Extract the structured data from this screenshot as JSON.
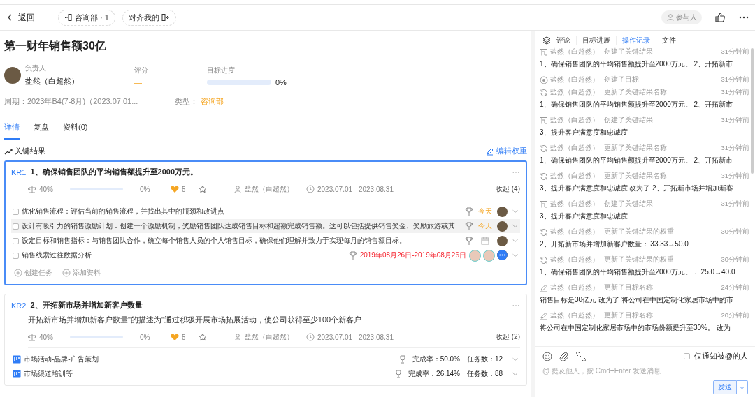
{
  "top_bar": {
    "back": "返回",
    "chips": [
      {
        "label": "咨询部 · 1",
        "kind": "in"
      },
      {
        "label": "对齐我的",
        "kind": "out"
      }
    ],
    "participants": "参与人"
  },
  "objective": {
    "title": "第一财年销售额30亿",
    "owner_label": "负责人",
    "owner": "盐然（白超然）",
    "score_label": "评分",
    "score": "—",
    "progress_label": "目标进度",
    "level": 0,
    "progress_text": "0%",
    "period": "周期：2023年B4(7-8月)（2023.07.01...",
    "type_label": "类型：",
    "type": "咨询部"
  },
  "tabs": [
    {
      "label": "详情",
      "selected": true
    },
    {
      "label": "复盘",
      "selected": false
    },
    {
      "label": "资料(0)",
      "selected": false
    }
  ],
  "section": {
    "title": "关键结果",
    "edit": "编辑权重"
  },
  "key_results": [
    {
      "code": "KR1",
      "title": "1、确保销售团队的平均销售额提升至2000万元。",
      "selected": true,
      "weight": "40%",
      "level": 0,
      "progress": "0%",
      "likes": "5",
      "rating": "—",
      "owner": "盐然（白超然）",
      "dates": "2023.07.01 - 2023.08.31",
      "collapse": "收起 (4)",
      "items": [
        {
          "kind": "task",
          "checked": false,
          "highlighted": false,
          "text": "优化销售流程：评估当前的销售流程，并找出其中的瓶颈和改进点",
          "due": "今天",
          "overdue": false,
          "avatars": [
            {
              "kind": "photo"
            }
          ]
        },
        {
          "kind": "task",
          "checked": false,
          "highlighted": true,
          "text": "设计有吸引力的销售激励计划：创建一个激励机制，奖励销售团队达成销售目标和超额完成销售额。这可以包括提供销售奖金、奖励旅游或其",
          "due": "今天",
          "overdue": false,
          "avatars": [
            {
              "kind": "photo"
            }
          ]
        },
        {
          "kind": "task",
          "checked": false,
          "highlighted": false,
          "text": "设定目标和销售指标：与销售团队合作，确立每个销售人员的个人销售目标，确保他们理解并致力于实现每月的销售额目标。",
          "avatars": [
            {
              "kind": "photo"
            }
          ]
        },
        {
          "kind": "task",
          "checked": false,
          "highlighted": false,
          "text": "销售线索过往数据分析",
          "due": "2019年08月26日-2019年08月26日",
          "overdue": true,
          "avatars": [
            {
              "kind": "cartoon"
            },
            {
              "kind": "cartoon"
            },
            {
              "kind": "more"
            }
          ]
        }
      ],
      "actions": [
        "创建任务",
        "添加资料"
      ]
    },
    {
      "code": "KR2",
      "title": "2、开拓新市场并增加新客户数量",
      "selected": false,
      "description": "开拓新市场并增加新客户数量\"的描述为\"通过积极开展市场拓展活动，使公司获得至少100个新客户",
      "weight": "40%",
      "level": 0,
      "progress": "0%",
      "likes": "5",
      "rating": "—",
      "owner": "盐然（白超然）",
      "dates": "2023.07.01 - 2023.08.31",
      "collapse": "收起 (2)",
      "items": [
        {
          "kind": "project",
          "text": "市场活动-品牌-广告策划",
          "rate": "完成率：50.0%",
          "count": "任务数：12"
        },
        {
          "kind": "project",
          "text": "市场渠道培训等",
          "rate": "完成率：26.14%",
          "count": "任务数：88"
        }
      ]
    }
  ],
  "side_tabs": [
    {
      "label": "评论",
      "selected": false
    },
    {
      "label": "目标进展",
      "selected": false
    },
    {
      "label": "操作记录",
      "selected": true
    },
    {
      "label": "文件",
      "selected": false
    }
  ],
  "log": [
    {
      "kind": "kr",
      "actor": "盐然（白超然）",
      "action": "创建了关键结果",
      "time": "31分钟前",
      "content": "1、确保销售团队的平均销售额提升至2000万元。 2、开拓新市"
    },
    {
      "kind": "target",
      "actor": "盐然（白超然）",
      "action": "创建了目标",
      "time": "31分钟前"
    },
    {
      "kind": "update",
      "actor": "盐然（白超然）",
      "action": "更新了关键结果名称",
      "time": "31分钟前",
      "content": "1、确保销售团队的平均销售额提升至2000万元。 2、开拓新市"
    },
    {
      "kind": "kr",
      "actor": "盐然（白超然）",
      "action": "创建了关键结果",
      "time": "31分钟前",
      "content": "3、提升客户满意度和忠诚度"
    },
    {
      "kind": "update",
      "actor": "盐然（白超然）",
      "action": "更新了关键结果名称",
      "time": "31分钟前",
      "content": "1、确保销售团队的平均销售额提升至2000万元。 2、开拓新市"
    },
    {
      "kind": "update",
      "actor": "盐然（白超然）",
      "action": "更新了关键结果名称",
      "time": "31分钟前",
      "content": "3、提升客户满意度和忠诚度 改为了  2、开拓新市场并增加新客"
    },
    {
      "kind": "kr",
      "actor": "盐然（白超然）",
      "action": "创建了关键结果",
      "time": "31分钟前",
      "content": "3、提升客户满意度和忠诚度"
    },
    {
      "kind": "update",
      "actor": "盐然（白超然）",
      "action": "更新了关键结果的权重",
      "time": "30分钟前",
      "content": " 2、开拓新市场并增加新客户数量： 33.33→50.0"
    },
    {
      "kind": "update",
      "actor": "盐然（白超然）",
      "action": "更新了关键结果的权重",
      "time": "30分钟前",
      "content": "1、确保销售团队的平均销售额提升至2000万元。： 25.0→40.0"
    },
    {
      "kind": "edit",
      "actor": "盐然（白超然）",
      "action": "更新了目标名称",
      "time": "24分钟前",
      "content": "销售目标是30亿元 改为了 将公司在中国定制化家居市场中的市"
    },
    {
      "kind": "edit",
      "actor": "盐然（白超然）",
      "action": "更新了目标名称",
      "time": "20分钟前",
      "content": "将公司在中国定制化家居市场中的市场份额提升至30%。 改为"
    }
  ],
  "composer": {
    "notify_label": "仅通知被@的人",
    "notify_checked": false,
    "placeholder": "@ 提及他人，按 Cmd+Enter 发送消息",
    "send": "发送"
  }
}
